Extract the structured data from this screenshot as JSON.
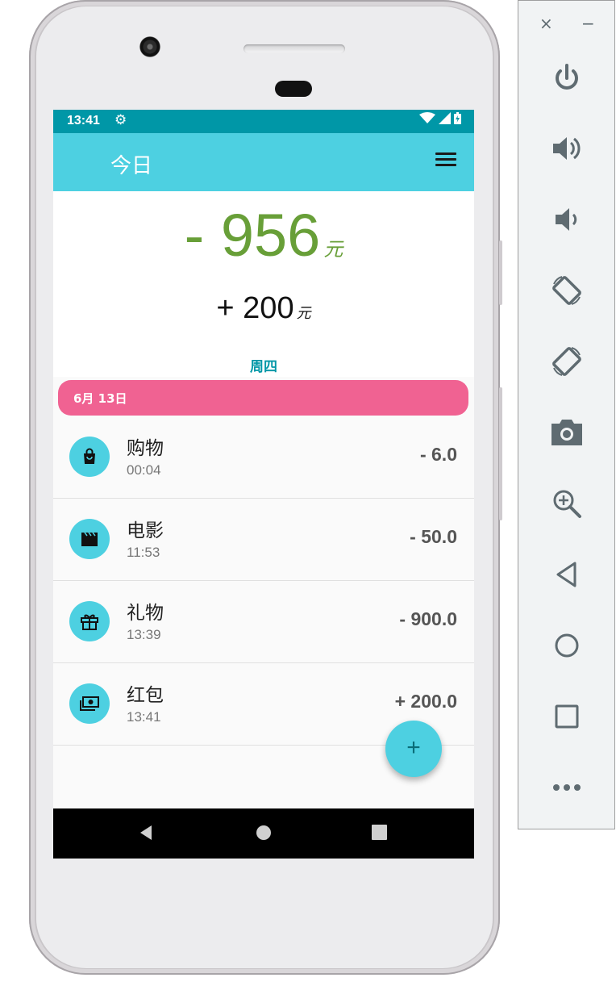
{
  "status_bar": {
    "time": "13:41"
  },
  "app_bar": {
    "title": "今日"
  },
  "summary": {
    "expense_total": "- 956",
    "expense_unit": "元",
    "income_total": "+ 200",
    "income_unit": "元",
    "weekday": "周四"
  },
  "date_header": "6月 13日",
  "transactions": [
    {
      "category": "购物",
      "time": "00:04",
      "amount": "- 6.0",
      "icon": "shopping-bag-icon"
    },
    {
      "category": "电影",
      "time": "11:53",
      "amount": "- 50.0",
      "icon": "movie-clapper-icon"
    },
    {
      "category": "礼物",
      "time": "13:39",
      "amount": "- 900.0",
      "icon": "gift-icon"
    },
    {
      "category": "红包",
      "time": "13:41",
      "amount": "+ 200.0",
      "icon": "money-icon"
    }
  ],
  "fab": {
    "label": "+"
  },
  "emulator": {
    "window_controls": {
      "close": "×",
      "minimize": "−"
    },
    "tools": [
      "power-icon",
      "volume-up-icon",
      "volume-down-icon",
      "rotate-left-icon",
      "rotate-right-icon",
      "screenshot-camera-icon",
      "zoom-icon",
      "back-icon",
      "home-icon",
      "overview-icon",
      "more-icon"
    ]
  },
  "colors": {
    "status_bar": "#0097a7",
    "app_bar": "#4dd0e1",
    "expense": "#689f38",
    "date_header": "#f06292",
    "weekday": "#0097a7"
  }
}
